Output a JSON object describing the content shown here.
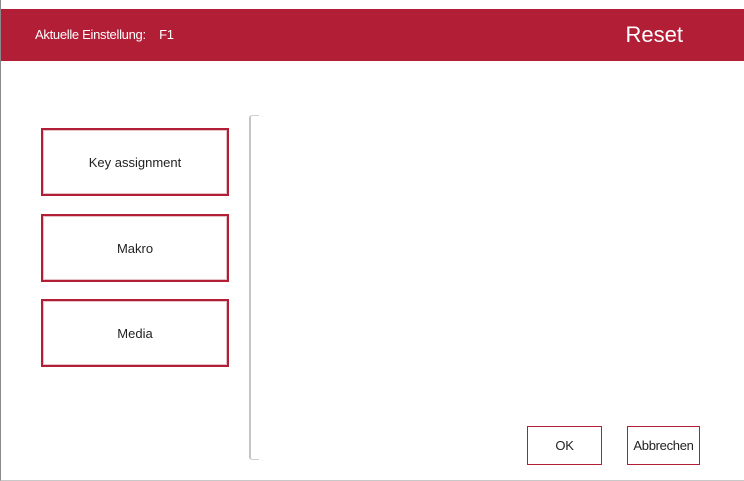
{
  "header": {
    "current_setting_label": "Aktuelle Einstellung:",
    "current_setting_value": "F1",
    "reset_label": "Reset",
    "accent_color": "#b11e36"
  },
  "nav": {
    "items": [
      {
        "label": "Key assignment"
      },
      {
        "label": "Makro"
      },
      {
        "label": "Media"
      }
    ]
  },
  "footer": {
    "ok_label": "OK",
    "cancel_label": "Abbrechen"
  }
}
